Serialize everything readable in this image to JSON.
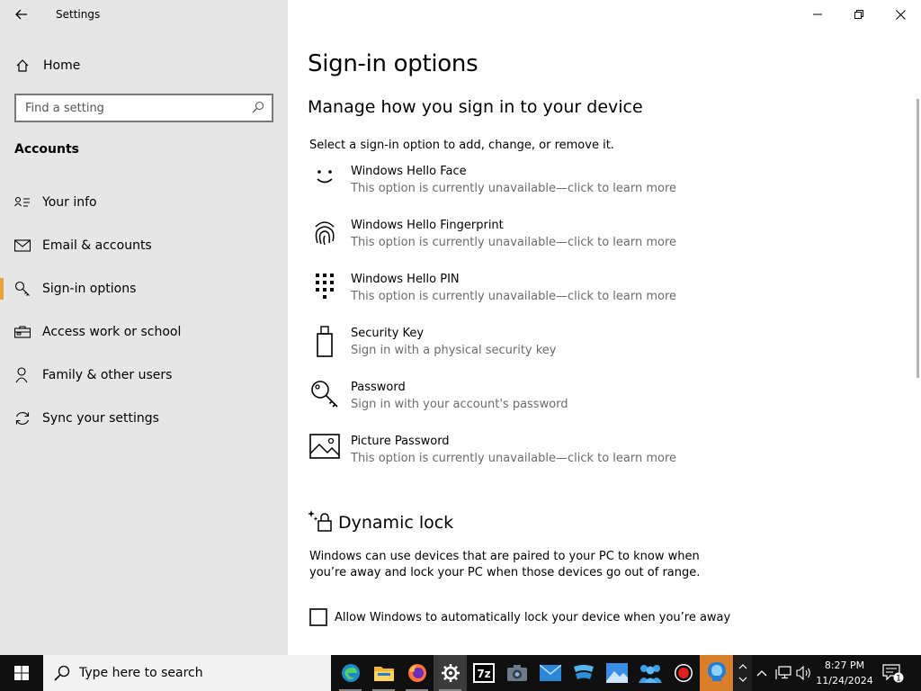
{
  "window": {
    "title": "Settings"
  },
  "sidebar": {
    "home_label": "Home",
    "search_placeholder": "Find a setting",
    "section_heading": "Accounts",
    "items": [
      {
        "label": "Your info",
        "icon": "person-card-icon"
      },
      {
        "label": "Email & accounts",
        "icon": "mail-icon"
      },
      {
        "label": "Sign-in options",
        "icon": "key-icon",
        "active": true
      },
      {
        "label": "Access work or school",
        "icon": "briefcase-icon"
      },
      {
        "label": "Family & other users",
        "icon": "person-add-icon"
      },
      {
        "label": "Sync your settings",
        "icon": "sync-icon"
      }
    ]
  },
  "main": {
    "title": "Sign-in options",
    "subtitle": "Manage how you sign in to your device",
    "intro": "Select a sign-in option to add, change, or remove it.",
    "options": [
      {
        "name": "Windows Hello Face",
        "desc": "This option is currently unavailable—click to learn more",
        "icon": "face-icon"
      },
      {
        "name": "Windows Hello Fingerprint",
        "desc": "This option is currently unavailable—click to learn more",
        "icon": "fingerprint-icon"
      },
      {
        "name": "Windows Hello PIN",
        "desc": "This option is currently unavailable—click to learn more",
        "icon": "pin-keypad-icon"
      },
      {
        "name": "Security Key",
        "desc": "Sign in with a physical security key",
        "icon": "usb-key-icon"
      },
      {
        "name": "Password",
        "desc": "Sign in with your account's password",
        "icon": "password-key-icon"
      },
      {
        "name": "Picture Password",
        "desc": "This option is currently unavailable—click to learn more",
        "icon": "picture-icon"
      }
    ],
    "dynamic_lock": {
      "title": "Dynamic lock",
      "description": "Windows can use devices that are paired to your PC to know when you’re away and lock your PC when those devices go out of range.",
      "checkbox_label": "Allow Windows to automatically lock your device when you’re away",
      "checked": false
    }
  },
  "taskbar": {
    "search_text": "Type here to search",
    "apps": [
      "edge-icon",
      "file-explorer-icon",
      "firefox-icon",
      "settings-gear-icon",
      "7zip-icon",
      "camera-icon",
      "mail-app-icon",
      "vpn-icon",
      "photos-icon",
      "people-icon",
      "recorder-icon",
      "bulb-app-icon"
    ],
    "time": "8:27 PM",
    "date": "11/24/2024",
    "notification_count": "1"
  },
  "colors": {
    "accent": "#e8a33a",
    "sidebar_bg": "#e6e6e6",
    "taskbar_bg": "#101010"
  }
}
